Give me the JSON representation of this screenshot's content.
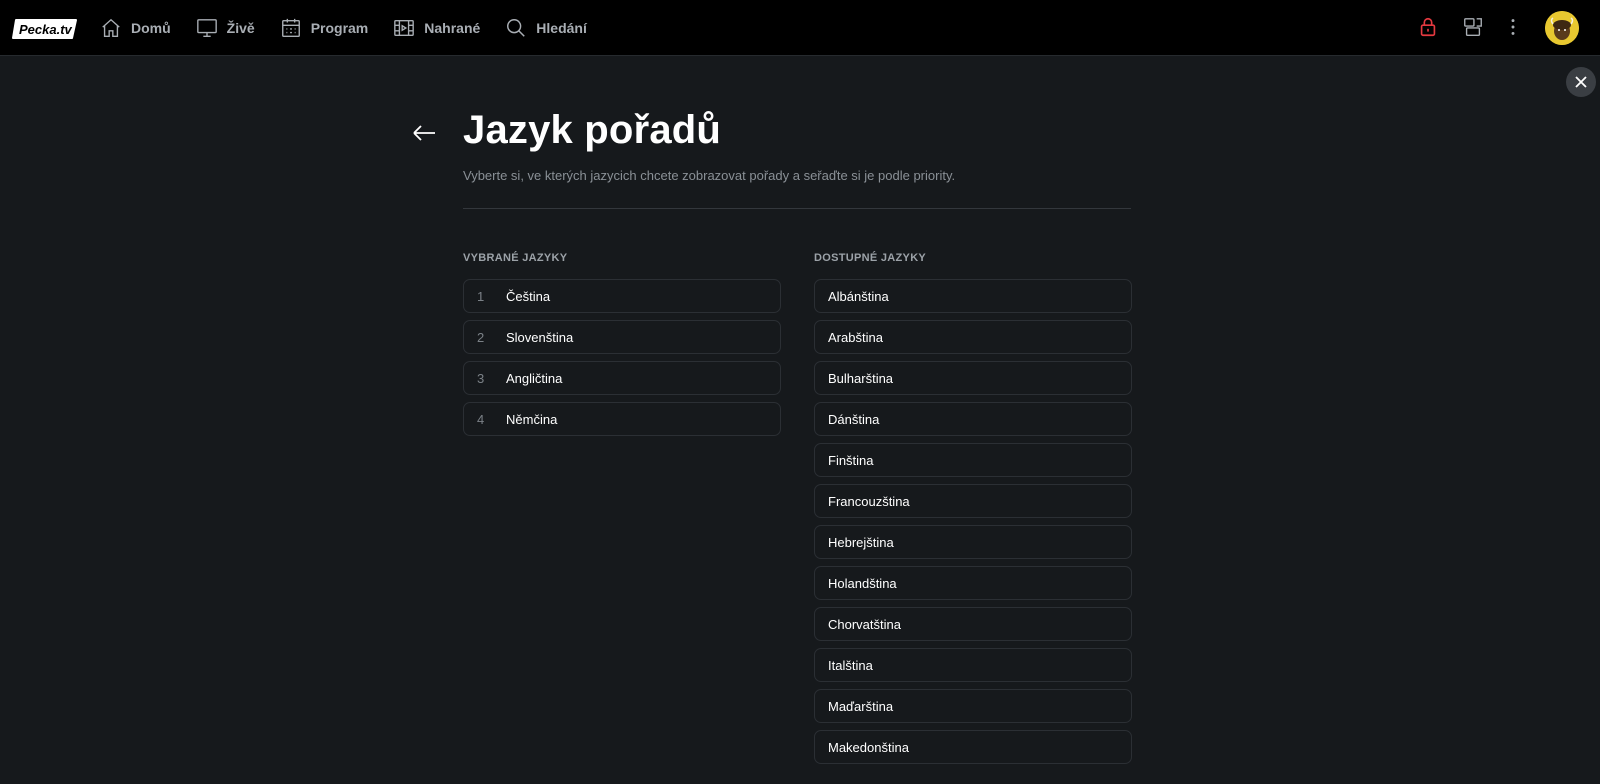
{
  "header": {
    "logo_text": "Pecka.tv",
    "nav": [
      {
        "label": "Domů",
        "icon": "home-icon"
      },
      {
        "label": "Živě",
        "icon": "tv-icon"
      },
      {
        "label": "Program",
        "icon": "calendar-icon"
      },
      {
        "label": "Nahrané",
        "icon": "film-icon"
      },
      {
        "label": "Hledání",
        "icon": "search-icon"
      }
    ],
    "right_icons": [
      "lock-icon",
      "devices-icon",
      "more-vertical-icon"
    ],
    "lock_color": "#e53940"
  },
  "page": {
    "title": "Jazyk pořadů",
    "subtitle": "Vyberte si, ve kterých jazycich chcete zobrazovat pořady a seřaďte si je podle priority."
  },
  "selected": {
    "heading": "VYBRANÉ JAZYKY",
    "items": [
      {
        "index": "1",
        "label": "Čeština"
      },
      {
        "index": "2",
        "label": "Slovenština"
      },
      {
        "index": "3",
        "label": "Angličtina"
      },
      {
        "index": "4",
        "label": "Němčina"
      }
    ]
  },
  "available": {
    "heading": "DOSTUPNÉ JAZYKY",
    "items": [
      {
        "label": "Albánština"
      },
      {
        "label": "Arabština"
      },
      {
        "label": "Bulharština"
      },
      {
        "label": "Dánština"
      },
      {
        "label": "Finština"
      },
      {
        "label": "Francouzština"
      },
      {
        "label": "Hebrejština"
      },
      {
        "label": "Holandština"
      },
      {
        "label": "Chorvatština"
      },
      {
        "label": "Italština"
      },
      {
        "label": "Maďarština"
      },
      {
        "label": "Makedonština"
      }
    ]
  }
}
